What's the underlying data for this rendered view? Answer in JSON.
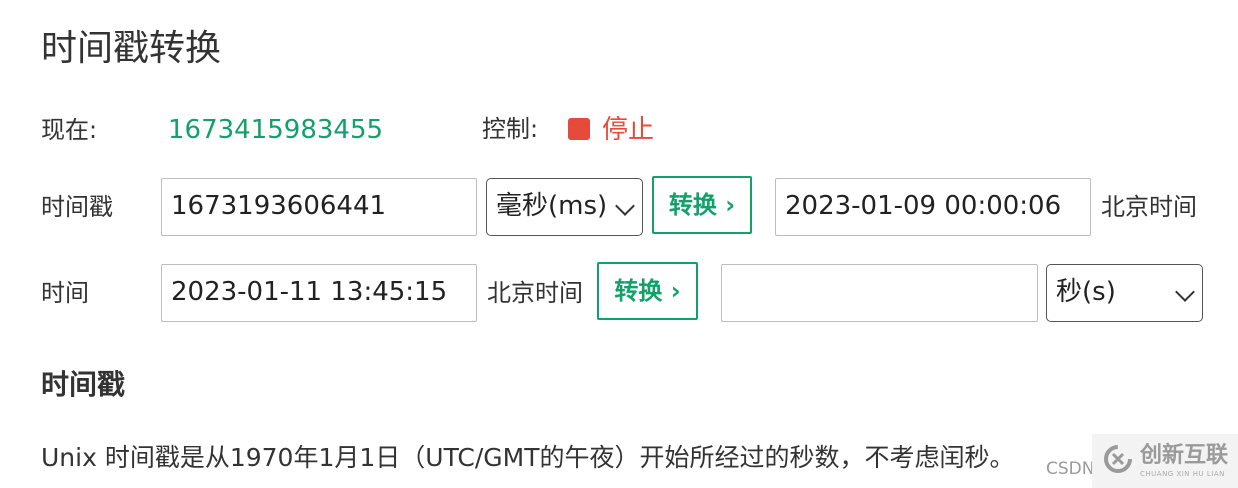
{
  "page": {
    "title": "时间戳转换"
  },
  "now": {
    "label": "现在:",
    "value": "1673415983455"
  },
  "control": {
    "label": "控制:",
    "stop_label": "停止",
    "stop_color": "#e64a3b",
    "stop_icon": "stop-square-icon"
  },
  "row_timestamp": {
    "label": "时间戳",
    "input_value": "1673193606441",
    "unit_select": "毫秒(ms)",
    "convert_label": "转换 ›",
    "result_value": "2023-01-09 00:00:06",
    "timezone_label": "北京时间"
  },
  "row_time": {
    "label": "时间",
    "input_value": "2023-01-11 13:45:15",
    "timezone_label": "北京时间",
    "convert_label": "转换 ›",
    "result_value": "",
    "unit_select": "秒(s)"
  },
  "section": {
    "title": "时间戳",
    "description": "Unix 时间戳是从1970年1月1日（UTC/GMT的午夜）开始所经过的秒数，不考虑闰秒。"
  },
  "watermark": {
    "csdn": "CSDN",
    "brand": "创新互联",
    "brand_sub": "CHUANG XIN HU LIAN"
  },
  "colors": {
    "accent": "#12a06b",
    "danger": "#e64a3b"
  }
}
